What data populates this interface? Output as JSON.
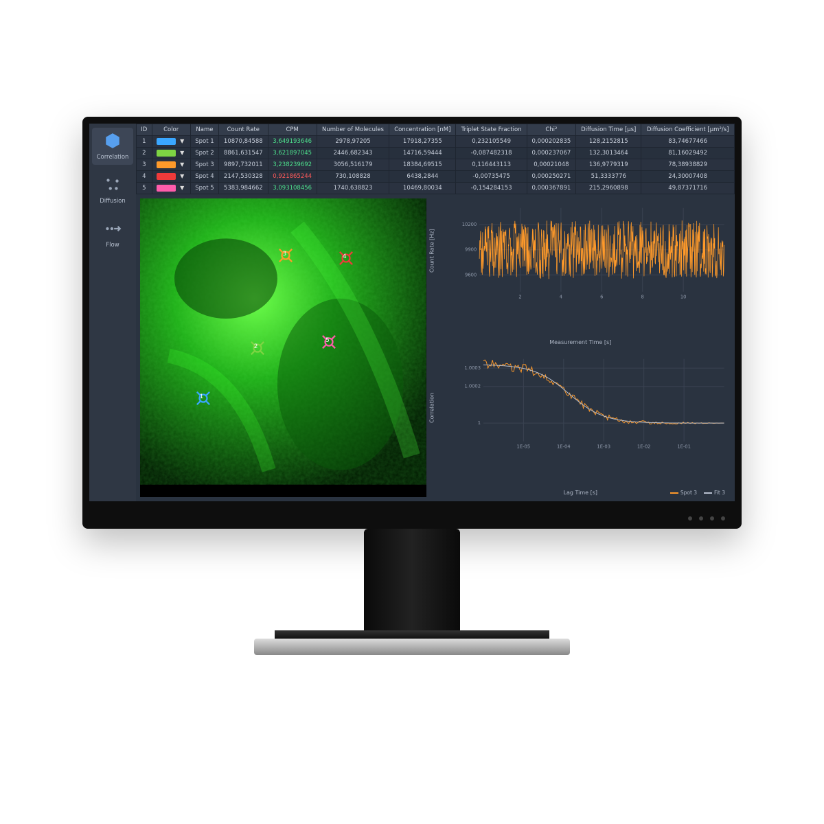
{
  "sidebar": {
    "items": [
      {
        "label": "Correlation",
        "icon": "hex-icon",
        "active": true
      },
      {
        "label": "Diffusion",
        "icon": "diffusion-icon",
        "active": false
      },
      {
        "label": "Flow",
        "icon": "flow-icon",
        "active": false
      }
    ]
  },
  "table": {
    "headers": [
      "ID",
      "Color",
      "Name",
      "Count Rate",
      "CPM",
      "Number of Molecules",
      "Concentration [nM]",
      "Triplet State Fraction",
      "Chi²",
      "Diffusion Time [µs]",
      "Diffusion Coefficient [µm²/s]"
    ],
    "rows": [
      {
        "id": "1",
        "color": "#3aa7ff",
        "name": "Spot 1",
        "count_rate": "10870,84588",
        "cpm": "3,649193646",
        "cpm_style": "green",
        "molecules": "2978,97205",
        "concentration": "17918,27355",
        "triplet": "0,232105549",
        "chi": "0,000202835",
        "diff_time": "128,2152815",
        "diff_coef": "83,74677466"
      },
      {
        "id": "2",
        "color": "#7ed443",
        "name": "Spot 2",
        "count_rate": "8861,631547",
        "cpm": "3,621897045",
        "cpm_style": "green",
        "molecules": "2446,682343",
        "concentration": "14716,59444",
        "triplet": "-0,087482318",
        "chi": "0,000237067",
        "diff_time": "132,3013464",
        "diff_coef": "81,16029492"
      },
      {
        "id": "3",
        "color": "#ff9a2a",
        "name": "Spot 3",
        "count_rate": "9897,732011",
        "cpm": "3,238239692",
        "cpm_style": "green",
        "molecules": "3056,516179",
        "concentration": "18384,69515",
        "triplet": "0,116443113",
        "chi": "0,00021048",
        "diff_time": "136,9779319",
        "diff_coef": "78,38938829"
      },
      {
        "id": "4",
        "color": "#ef3a3a",
        "name": "Spot 4",
        "count_rate": "2147,530328",
        "cpm": "0,921865244",
        "cpm_style": "red",
        "molecules": "730,108828",
        "concentration": "6438,2844",
        "triplet": "-0,00735475",
        "chi": "0,000250271",
        "diff_time": "51,3333776",
        "diff_coef": "24,30007408"
      },
      {
        "id": "5",
        "color": "#ff5cab",
        "name": "Spot 5",
        "count_rate": "5383,984662",
        "cpm": "3,093108456",
        "cpm_style": "green",
        "molecules": "1740,638823",
        "concentration": "10469,80034",
        "triplet": "-0,154284153",
        "chi": "0,000367891",
        "diff_time": "215,2960898",
        "diff_coef": "49,87371716"
      }
    ]
  },
  "markers": [
    {
      "n": "1",
      "color": "#3aa7ff",
      "x": 22,
      "y": 67
    },
    {
      "n": "2",
      "color": "#7ed443",
      "x": 41,
      "y": 50
    },
    {
      "n": "3",
      "color": "#ff9a2a",
      "x": 51,
      "y": 19
    },
    {
      "n": "4",
      "color": "#ef3a3a",
      "x": 72,
      "y": 20
    },
    {
      "n": "5",
      "color": "#ff5cab",
      "x": 66,
      "y": 48
    }
  ],
  "chart_data": [
    {
      "type": "line",
      "title": "",
      "xlabel": "Measurement Time [s]",
      "ylabel": "Count Rate [Hz]",
      "x_ticks": [
        "2",
        "4",
        "6",
        "8",
        "10"
      ],
      "y_ticks": [
        "9600",
        "9900",
        "10200"
      ],
      "ylim": [
        9400,
        10400
      ],
      "xlim": [
        0,
        12
      ],
      "series": [
        {
          "name": "Spot 3",
          "color": "#ff9a2a",
          "mean": 9900,
          "noise_amp": 350
        }
      ]
    },
    {
      "type": "line",
      "title": "",
      "xlabel": "Lag Time [s]",
      "ylabel": "Correlation",
      "x_scale": "log",
      "x_ticks": [
        "1E-05",
        "1E-04",
        "1E-03",
        "1E-02",
        "1E-01"
      ],
      "y_ticks": [
        "1",
        "1.0002",
        "1.0003"
      ],
      "ylim": [
        0.9999,
        1.00035
      ],
      "series": [
        {
          "name": "Spot 3",
          "color": "#ff9a2a"
        },
        {
          "name": "Fit 3",
          "color": "#b8c0cf"
        }
      ],
      "legend": [
        {
          "label": "Spot 3",
          "color": "#ff9a2a"
        },
        {
          "label": "Fit 3",
          "color": "#b8c0cf"
        }
      ]
    }
  ]
}
